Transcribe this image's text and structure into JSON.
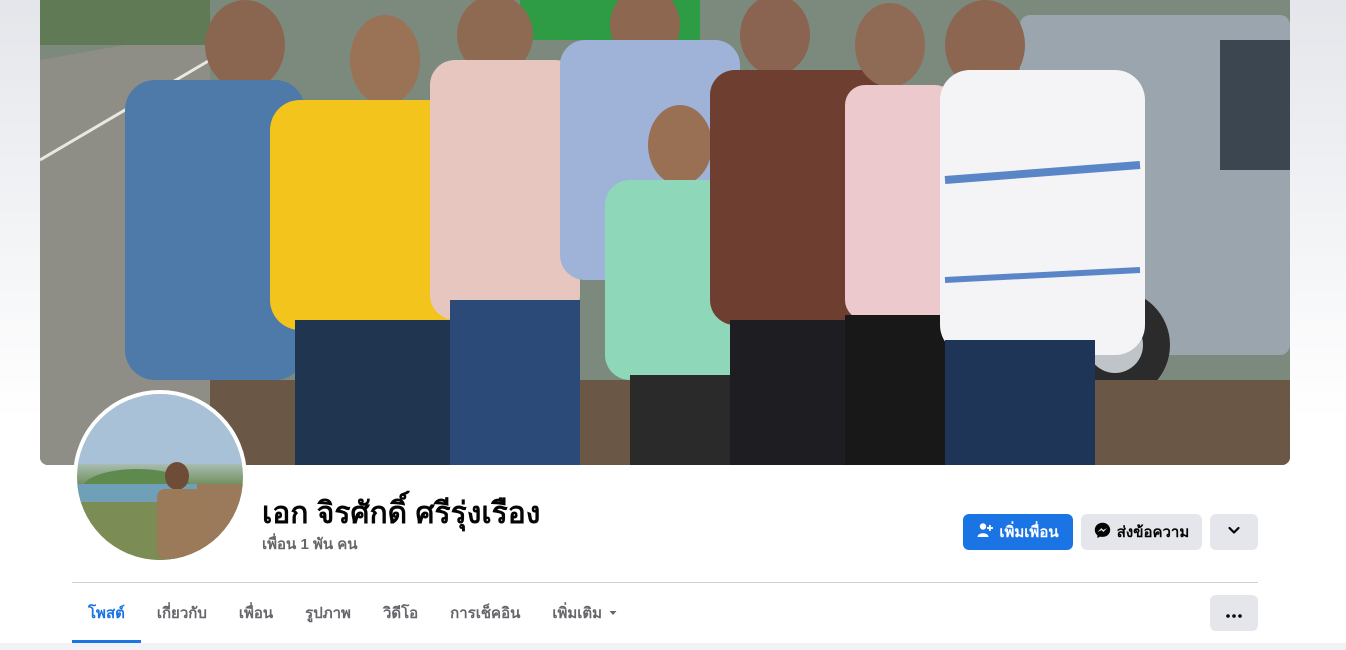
{
  "profile": {
    "name": "เอก จิรศักดิ์ ศรีรุ่งเรือง",
    "friends_count": "เพื่อน 1 พัน คน"
  },
  "actions": {
    "add_friend_label": "เพิ่มเพื่อน",
    "message_label": "ส่งข้อความ",
    "add_friend_icon": "person-plus-icon",
    "message_icon": "messenger-icon",
    "more_icon": "chevron-down-icon"
  },
  "tabs": [
    {
      "label": "โพสต์",
      "active": true
    },
    {
      "label": "เกี่ยวกับ"
    },
    {
      "label": "เพื่อน"
    },
    {
      "label": "รูปภาพ"
    },
    {
      "label": "วิดีโอ"
    },
    {
      "label": "การเช็คอิน"
    },
    {
      "label": "เพิ่มเติม"
    }
  ],
  "colors": {
    "accent": "#1b74e4",
    "secondary_button": "#e4e6eb",
    "muted_text": "#65676b"
  }
}
